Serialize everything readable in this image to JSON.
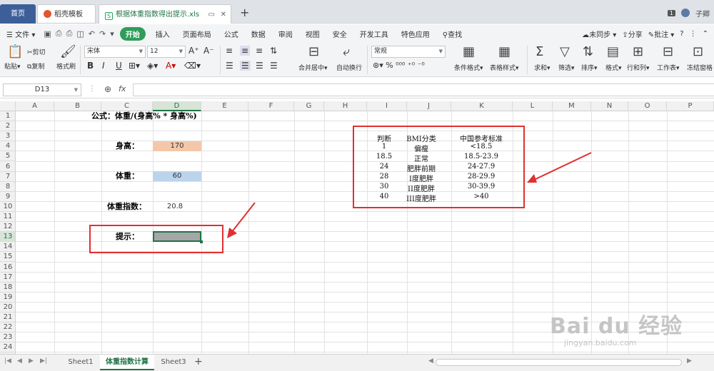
{
  "tabs": {
    "home": "首页",
    "docer": "稻壳模板",
    "file": "根据体重指数得出提示.xls",
    "file_icon": "S"
  },
  "titlebar_right": {
    "count": "1",
    "user": "子卿"
  },
  "menu": {
    "file": "文件",
    "items": [
      "开始",
      "插入",
      "页面布局",
      "公式",
      "数据",
      "审阅",
      "视图",
      "安全",
      "开发工具",
      "特色应用"
    ],
    "search": "查找",
    "sync": "未同步",
    "share": "分享",
    "comment": "批注"
  },
  "ribbon": {
    "paste": "粘贴",
    "cut": "剪切",
    "copy": "复制",
    "format_painter": "格式刷",
    "font": "宋体",
    "size": "12",
    "bold": "B",
    "italic": "I",
    "underline": "U",
    "merge": "合并居中",
    "wrap": "自动换行",
    "numfmt": "常规",
    "cond": "条件格式",
    "tablestyle": "表格样式",
    "sum": "求和",
    "filter": "筛选",
    "sort": "排序",
    "format": "格式",
    "rowcol": "行和列",
    "sheet": "工作表",
    "freeze": "冻结窗格"
  },
  "formula": {
    "namebox": "D13",
    "fx": "fx"
  },
  "columns": [
    "A",
    "B",
    "C",
    "D",
    "E",
    "F",
    "G",
    "H",
    "I",
    "J",
    "K",
    "L",
    "M",
    "N",
    "O",
    "P"
  ],
  "rows": [
    "1",
    "2",
    "3",
    "4",
    "5",
    "6",
    "7",
    "8",
    "9",
    "10",
    "11",
    "12",
    "13",
    "14",
    "15",
    "16",
    "17",
    "18",
    "19",
    "20",
    "21",
    "22",
    "23",
    "24"
  ],
  "cells": {
    "formula_label": "公式：体重/(身高% * 身高%)",
    "height_label": "身高：",
    "height_value": "170",
    "weight_label": "体重：",
    "weight_value": "60",
    "bmi_label": "体重指数：",
    "bmi_value": "20.8",
    "hint_label": "提示："
  },
  "bmi_table": {
    "headers": [
      "判断",
      "BMI分类",
      "中国参考标准"
    ],
    "rows": [
      [
        "1",
        "偏瘦",
        "<18.5"
      ],
      [
        "18.5",
        "正常",
        "18.5-23.9"
      ],
      [
        "24",
        "肥胖前期",
        "24-27.9"
      ],
      [
        "28",
        "I度肥胖",
        "28-29.9"
      ],
      [
        "30",
        "II度肥胖",
        "30-39.9"
      ],
      [
        "40",
        "III度肥胖",
        ">40"
      ]
    ]
  },
  "sheets": [
    "Sheet1",
    "体重指数计算",
    "Sheet3"
  ],
  "watermark": {
    "brand": "Bai du 经验",
    "url": "jingyan.baidu.com"
  },
  "colors": {
    "height_fill": "#f4c7a8",
    "weight_fill": "#bcd3ec",
    "hint_fill": "#a6a6a6",
    "annotation": "#e03030",
    "accent": "#217346"
  }
}
